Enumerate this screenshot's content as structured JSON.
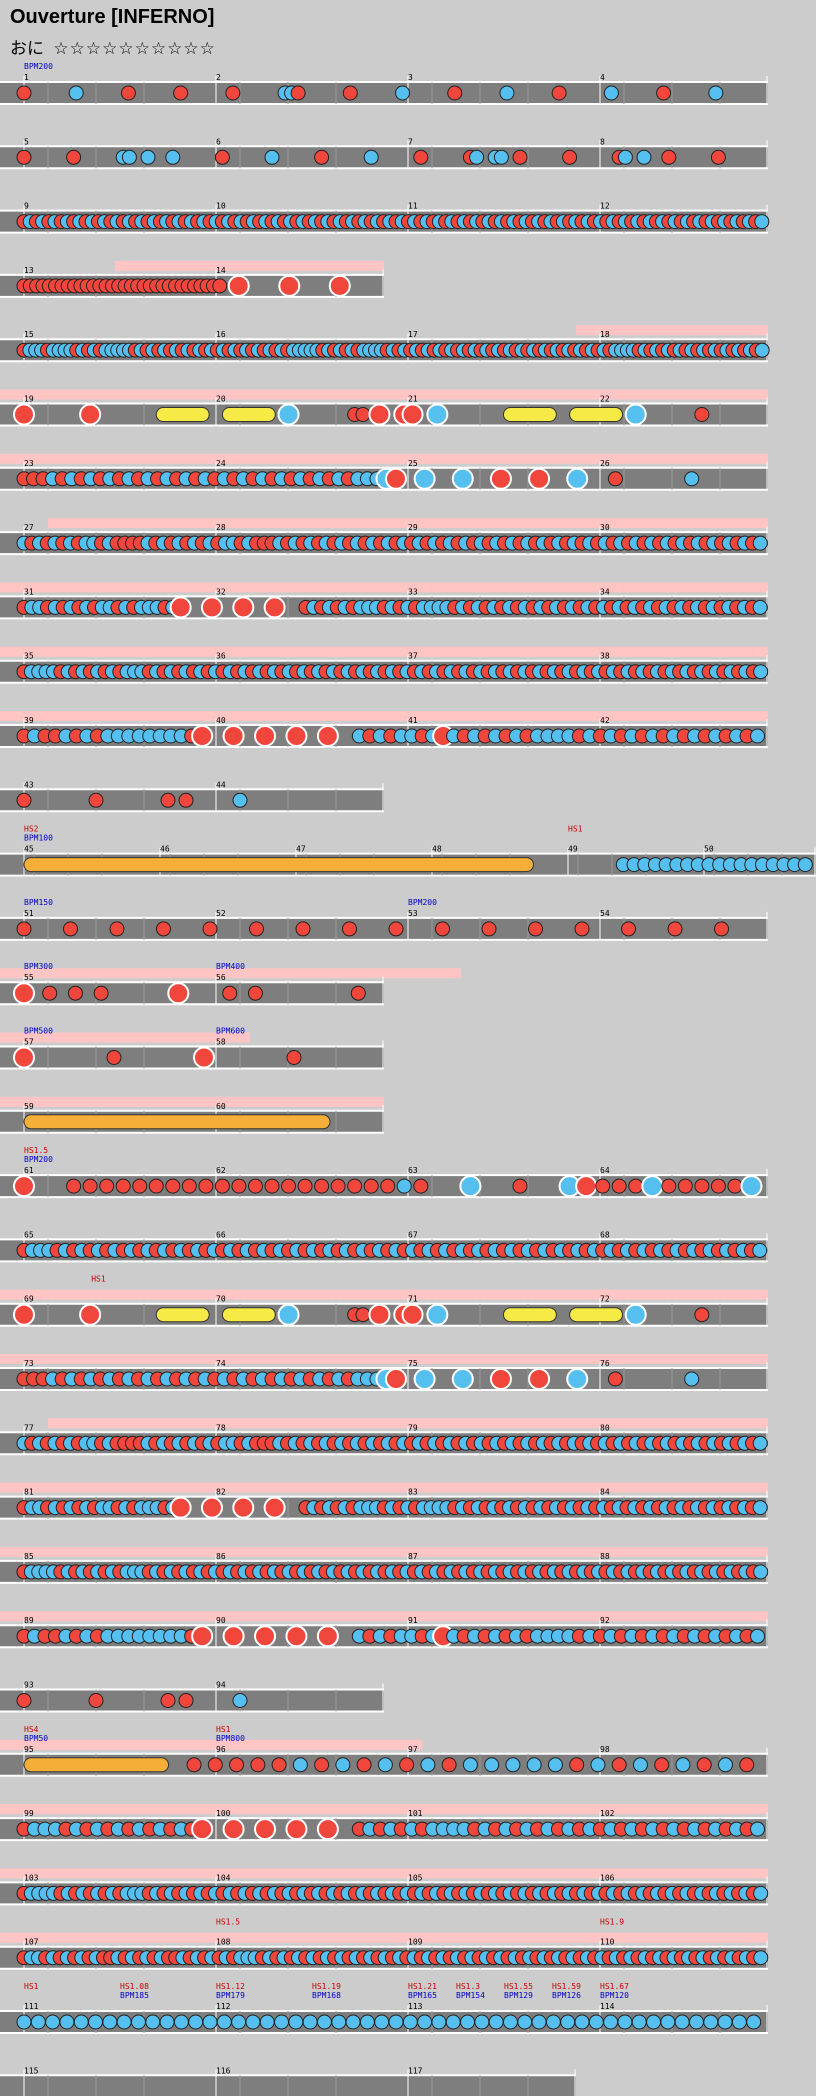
{
  "song": {
    "title": "Ouverture [INFERNO]",
    "difficulty_label": "おに",
    "difficulty_stars": "☆☆☆☆☆☆☆☆☆☆",
    "stars_count": 10
  },
  "colors": {
    "background": "#cccccc",
    "lane": "#7e7e7e",
    "lane_dark": "#5a5a5a",
    "don": "#f0463c",
    "ka": "#55c0ef",
    "drumroll": "#f5ea46",
    "balloon": "#f5ae38",
    "gogo": "#ffc4c4",
    "bpm_text": "#0000cc",
    "hs_text": "#cc0000",
    "measure_number": "#000000"
  },
  "legend": {
    "don": "don-note",
    "ka": "ka-note",
    "don_big": "big-don-note",
    "ka_big": "big-ka-note",
    "roll": "drumroll-note",
    "balloon": "balloon-note"
  },
  "chart_data": {
    "type": "taiko-chart",
    "title": "Ouverture [INFERNO]",
    "course": "おに",
    "stars": 10,
    "rows": [
      {
        "measures": [
          1,
          2,
          3,
          4
        ],
        "gogo": [],
        "labels": [
          {
            "bpm": "BPM200",
            "at": 0
          }
        ],
        "notes": "d.......k.......d.......d.......d.......kkd.......d.......k.......d.......k.......d.......k.......d.......k......."
      },
      {
        "measures": [
          5,
          6,
          7,
          8
        ],
        "gogo": [],
        "labels": [],
        "notes": "d.......d.......kk..k...k.......d.......k.......d.......k.......d.......dk..kk..d.......d.......dk..k...d.......d......."
      },
      {
        "measures": [
          9,
          10,
          11,
          12
        ],
        "gogo": [],
        "labels": [],
        "notes": "dkdkdkdkdkdkdkdkdkdkdkdkdkdkdkdkdkdkdkdkdkdkdkdkdkdkdkdkdkdkdkdkdkdkdkdkdkdkdkdkdkdkdkdkdkdkdkdkdkdkdkdkdkdkdkdkdkdkdkdk"
      },
      {
        "measures": [
          13,
          14
        ],
        "gogo": [
          [
            0.6,
            2.0
          ]
        ],
        "labels": [],
        "notes": "dddddddddddddddddddddddddddddddd..D.......D.......D......"
      },
      {
        "measures": [
          15,
          16,
          17,
          18
        ],
        "gogo": [
          [
            3.0,
            4.0
          ]
        ],
        "labels": [],
        "notes": "dkkkdkkkkdkdkdkkkkkdkdkdkdkdkdkdkdkdkdkdkdkdkdkkkkkdkdkdkdkkkkdkdkdkdkdkdkdkdkdkdkdkdkdkdkdkdkdkdkdkdkkkkdkdkdkdkdkdkdkdkdkdkdk"
      },
      {
        "measures": [
          19,
          20,
          21,
          22
        ],
        "gogo": [
          [
            0.0,
            4.0
          ]
        ],
        "labels": [],
        "notes": "D.......D.......R.......R.......K.......dd.D..DD..K.......R.......R.......K.......d......."
      },
      {
        "measures": [
          23,
          24,
          25,
          26
        ],
        "gogo": [
          [
            0.0,
            4.0
          ]
        ],
        "labels": [],
        "notes": "dddkdkdkdkdkdkdkdkdkdkdkdkdkdkdkdkdkkkKD..K...K...D...D...K...d.......k......."
      },
      {
        "measures": [
          27,
          28,
          29,
          30
        ],
        "gogo": [
          [
            0.25,
            4.0
          ]
        ],
        "labels": [],
        "notes": "kdkdkdkdkkdkddddkdkdkdkdkdkkdkdddkdkdkdkdkdkdkdkdkdkdkdkdkdkdkdkdkdkdkdkdkdkdkdkdkdkdkdkdkdkdkdk"
      },
      {
        "measures": [
          31,
          32,
          33,
          34
        ],
        "gogo": [
          [
            0.0,
            4.0
          ]
        ],
        "labels": [],
        "notes": "dkkdkdkdkdkkdkdkkkdkD...D...D...D...dkdkdkdkkkdkdkdkkkkdkdkdkdkdkdkdkdkdkdkdkdkdkdkdkdkdkdkdkdk"
      },
      {
        "measures": [
          35,
          36,
          37,
          38
        ],
        "gogo": [
          [
            0.0,
            4.0
          ]
        ],
        "labels": [],
        "notes": "dkkkkdkdkdkdkdkkkdkdkdkdkdkdkdkdkdkdkdkdkdkdkdkdkdkdkdkdkdkdkdkdkdkdkdkdkdkdkdkdkdkdkdkdkdkdkdkdkdkdk"
      },
      {
        "measures": [
          39,
          40,
          41,
          42
        ],
        "gogo": [
          [
            0.0,
            4.0
          ]
        ],
        "labels": [],
        "notes": "dkddkdkdkkkkkkkkdD..D..D..D..D..kdkdkkdkDkdkdkdkdkkkkdkdkdkdkdkdkdkdkdk"
      },
      {
        "measures": [
          43,
          44
        ],
        "gogo": [],
        "labels": [],
        "notes": "d.......d.......d.d.....k..............."
      },
      {
        "measures": [
          45,
          46,
          47,
          48,
          49,
          50
        ],
        "gogo": [],
        "labels": [
          {
            "bpm": "BPM100",
            "hs": "HS2",
            "at": 0
          },
          {
            "hs": "HS1",
            "at": 4
          }
        ],
        "notes": "B.......................................................kkkkkkkkkkkkkkkkkk"
      },
      {
        "measures": [
          51,
          52,
          53,
          54
        ],
        "gogo": [],
        "labels": [
          {
            "bpm": "BPM150",
            "at": 0
          },
          {
            "bpm": "BPM200",
            "at": 2
          }
        ],
        "notes": "dddddddddddddddd"
      },
      {
        "measures": [
          55,
          56
        ],
        "gogo": [
          [
            0.0,
            2.4
          ]
        ],
        "labels": [
          {
            "bpm": "BPM300",
            "at": 0
          },
          {
            "bpm": "BPM400",
            "at": 1
          }
        ],
        "notes": "Dddd..D.dd...d"
      },
      {
        "measures": [
          57,
          58
        ],
        "gogo": [
          [
            0.0,
            1.3
          ]
        ],
        "labels": [
          {
            "bpm": "BPM500",
            "at": 0
          },
          {
            "bpm": "BPM600",
            "at": 1
          }
        ],
        "notes": "D.d.D.d."
      },
      {
        "measures": [
          59,
          60
        ],
        "gogo": [
          [
            0.0,
            2.0
          ]
        ],
        "labels": [],
        "notes": "B..............."
      },
      {
        "measures": [
          61,
          62,
          63,
          64
        ],
        "gogo": [],
        "labels": [
          {
            "bpm": "BPM200",
            "hs": "HS1.5",
            "at": 0
          }
        ],
        "notes": "D..ddddddddddddddddddddkd..K..d..KDdddKdddddK"
      },
      {
        "measures": [
          65,
          66,
          67,
          68
        ],
        "gogo": [],
        "labels": [],
        "notes": "dkkkdkdkdkdkdkdkdkdkdkdkdkdkdkdkdkdkdkdkdkdkdkdkdkdkdkdkdkdkdkdkdkdkdkdkdkdkdkdkdkdkdkdkdk"
      },
      {
        "measures": [
          69,
          70,
          71,
          72
        ],
        "gogo": [
          [
            0.0,
            4.0
          ]
        ],
        "labels": [
          {
            "hs": "HS1",
            "at": 0.35
          }
        ],
        "notes": "D.......D.......R.......R.......K.......dd.D..DD..K.......R.......R.......K.......d......."
      },
      {
        "measures": [
          73,
          74,
          75,
          76
        ],
        "gogo": [
          [
            0.0,
            4.0
          ]
        ],
        "labels": [],
        "notes": "dddkdkdkdkdkdkdkdkdkdkdkdkdkdkdkdkdkkkKD..K...K...D...D...K...d.......k......."
      },
      {
        "measures": [
          77,
          78,
          79,
          80
        ],
        "gogo": [
          [
            0.25,
            4.0
          ]
        ],
        "labels": [],
        "notes": "kdkdkdkdkkdkddddkdkdkdkdkdkkdkdddkdkdkdkdkdkdkdkdkdkdkdkdkdkdkdkdkdkdkdkdkdkdkdkdkdkdkdkdkdkdkdk"
      },
      {
        "measures": [
          81,
          82,
          83,
          84
        ],
        "gogo": [
          [
            0.0,
            4.0
          ]
        ],
        "labels": [],
        "notes": "dkkdkdkdkdkkdkdkkkdkD...D...D...D...dkdkdkdkkkdkdkdkkkkdkdkdkdkdkdkdkdkdkdkdkdkdkdkdkdkdkdkdkdk"
      },
      {
        "measures": [
          85,
          86,
          87,
          88
        ],
        "gogo": [
          [
            0.0,
            4.0
          ]
        ],
        "labels": [],
        "notes": "dkkkkdkdkdkdkdkkkdkdkdkdkdkdkdkdkdkdkdkdkdkdkdkdkdkdkdkdkdkdkdkdkdkdkdkdkdkdkdkdkdkdkdkdkdkdkdkdkdkdk"
      },
      {
        "measures": [
          89,
          90,
          91,
          92
        ],
        "gogo": [
          [
            0.0,
            4.0
          ]
        ],
        "labels": [],
        "notes": "dkddkdkdkkkkkkkkdD..D..D..D..D..kdkdkkdkDkdkdkdkdkkkkdkdkdkdkdkdkdkdkdk"
      },
      {
        "measures": [
          93,
          94
        ],
        "gogo": [],
        "labels": [],
        "notes": "d.......d.......d.d.....k..............."
      },
      {
        "measures": [
          95,
          96,
          97,
          98
        ],
        "gogo": [
          [
            0.0,
            2.2
          ]
        ],
        "labels": [
          {
            "bpm": "BPM50",
            "hs": "HS4",
            "at": 0
          },
          {
            "bpm": "BPM800",
            "hs": "HS1",
            "at": 1
          }
        ],
        "notes": "B.......dddddkdkdkdkdkkkkkdkdkdkdkd"
      },
      {
        "measures": [
          99,
          100,
          101,
          102
        ],
        "gogo": [
          [
            0.0,
            4.0
          ]
        ],
        "labels": [],
        "notes": "dkkkdkdkdkdkdkdkdD..D..D..D..D..dkdkdkdkkkkdkdkdkdkdkdkdkdkdkdkdkdkdkdk"
      },
      {
        "measures": [
          103,
          104,
          105,
          106
        ],
        "gogo": [
          [
            0.0,
            4.0
          ]
        ],
        "labels": [],
        "notes": "dkkkkdkdkdkdkdkkkdkdkdkdkdkdkdkdkdkdkdkdkdkdkdkdkdkdkdkdkdkdkdkdkdkdkdkdkdkdkdkdkdkdkdkdkdkdkdkdkdkdk"
      },
      {
        "measures": [
          107,
          108,
          109,
          110
        ],
        "gogo": [
          [
            0.0,
            4.0
          ]
        ],
        "labels": [
          {
            "hs": "HS1.5",
            "at": 1
          },
          {
            "hs": "HS1.9",
            "at": 3
          }
        ],
        "notes": "dkkdkdkdkdkddkdkdkdkddkdkdkdkdkkkdkdkdkdkdkdkdkdkdkdkdkdkdkdkdkdkdkdkdkdkdkdkdkdkdkdkdkdkdkdkdkdkdkdkdk"
      },
      {
        "measures": [
          111,
          112,
          113,
          114
        ],
        "gogo": [],
        "labels": [
          {
            "hs": "HS1",
            "at": 0
          },
          {
            "bpm": "BPM185",
            "hs": "HS1.08",
            "at": 0.5
          },
          {
            "bpm": "BPM179",
            "hs": "HS1.12",
            "at": 1
          },
          {
            "bpm": "BPM168",
            "hs": "HS1.19",
            "at": 1.5
          },
          {
            "bpm": "BPM165",
            "hs": "HS1.21",
            "at": 2
          },
          {
            "bpm": "BPM154",
            "hs": "HS1.3",
            "at": 2.25
          },
          {
            "bpm": "BPM129",
            "hs": "HS1.55",
            "at": 2.5
          },
          {
            "bpm": "BPM126",
            "hs": "HS1.59",
            "at": 2.75
          },
          {
            "bpm": "BPM120",
            "hs": "HS1.67",
            "at": 3
          }
        ],
        "notes": "kkkkkkkkkkkkkkkkkkkkkkkkkkkkkkkkkkkkkkkkkkkkkkkkkkkk"
      },
      {
        "measures": [
          115,
          116,
          117
        ],
        "gogo": [],
        "labels": [],
        "notes": ""
      }
    ]
  }
}
